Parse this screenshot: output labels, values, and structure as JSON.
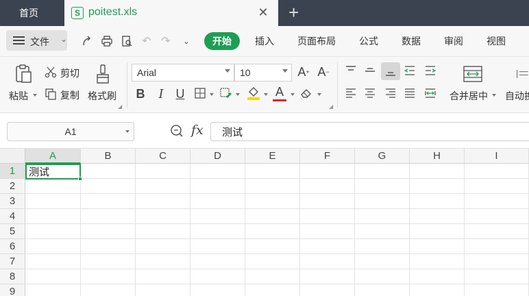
{
  "tabs": {
    "home_label": "首页",
    "file_icon": "S",
    "file_name": "poitest.xls",
    "close_glyph": "✕",
    "add_glyph": "+"
  },
  "menu": {
    "file_menu_label": "文件",
    "items": [
      {
        "label": "开始",
        "active": true
      },
      {
        "label": "插入",
        "active": false
      },
      {
        "label": "页面布局",
        "active": false
      },
      {
        "label": "公式",
        "active": false
      },
      {
        "label": "数据",
        "active": false
      },
      {
        "label": "审阅",
        "active": false
      },
      {
        "label": "视图",
        "active": false
      }
    ]
  },
  "ribbon": {
    "paste_label": "粘贴",
    "cut_label": "剪切",
    "copy_label": "复制",
    "format_painter_label": "格式刷",
    "font_name": "Arial",
    "font_size": "10",
    "bold": "B",
    "italic": "I",
    "underline": "U",
    "font_color_glyph": "A",
    "merge_label": "合并居中",
    "autowrap_label": "自动换"
  },
  "formula_bar": {
    "cell_ref": "A1",
    "fx_label": "fx",
    "content": "测试"
  },
  "sheet": {
    "columns": [
      "A",
      "B",
      "C",
      "D",
      "E",
      "F",
      "G",
      "H",
      "I"
    ],
    "rows": [
      "1",
      "2",
      "3",
      "4",
      "5",
      "6",
      "7",
      "8",
      "9"
    ],
    "a1_value": "测试"
  },
  "colors": {
    "accent": "#1e9e54",
    "titlebar": "#3c4350"
  }
}
